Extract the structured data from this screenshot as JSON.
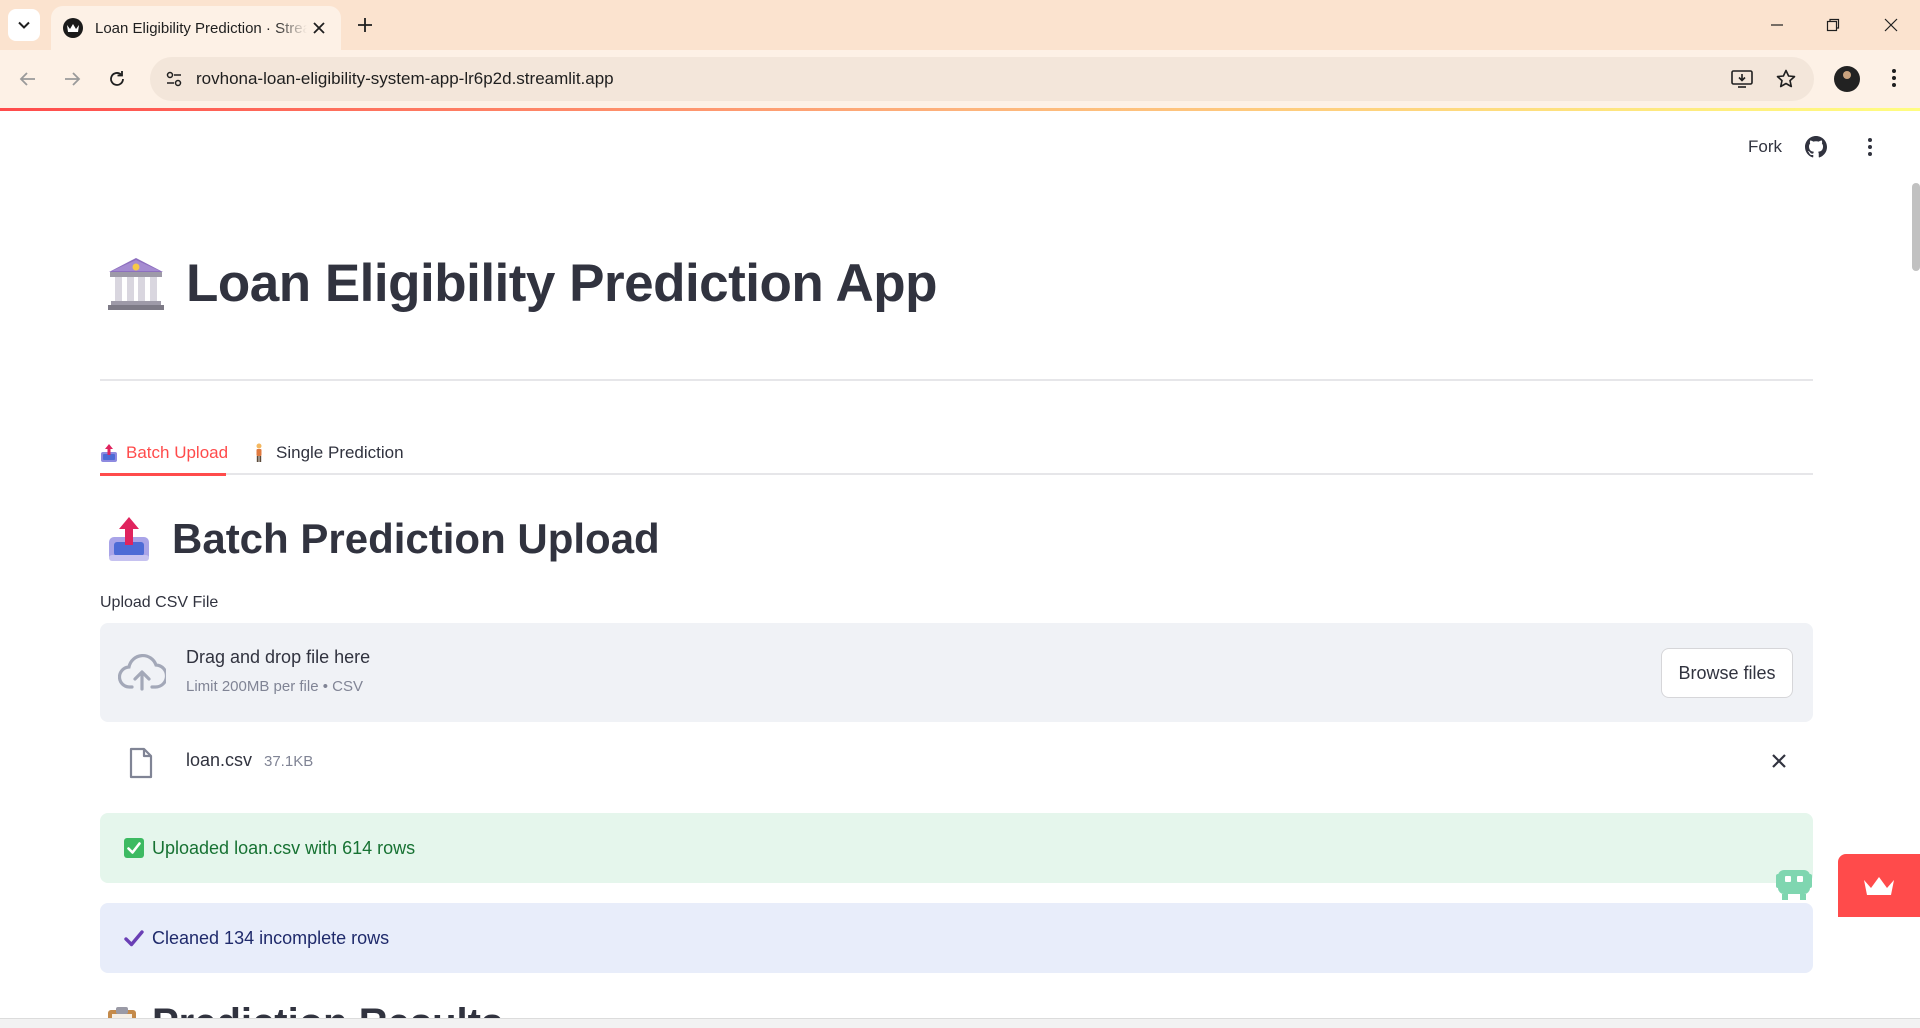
{
  "browser": {
    "tab_title": "Loan Eligibility Prediction · Streamlit",
    "url": "rovhona-loan-eligibility-system-app-lr6p2d.streamlit.app"
  },
  "header": {
    "fork_label": "Fork"
  },
  "page": {
    "title": "Loan Eligibility Prediction App",
    "title_icon": "bank-emoji"
  },
  "tabs": [
    {
      "label": "Batch Upload",
      "icon": "outbox-tray-emoji",
      "active": true
    },
    {
      "label": "Single Prediction",
      "icon": "person-standing-emoji",
      "active": false
    }
  ],
  "batch": {
    "subheader": "Batch Prediction Upload",
    "uploader_label": "Upload CSV File",
    "drop_title": "Drag and drop file here",
    "drop_limit": "Limit 200MB per file • CSV",
    "browse_label": "Browse files",
    "file": {
      "name": "loan.csv",
      "size": "37.1KB"
    },
    "success_message": "Uploaded loan.csv with 614 rows",
    "info_message": "Cleaned 134 incomplete rows",
    "next_section_partial": "Prediction Results"
  },
  "colors": {
    "accent": "#ff4b4b",
    "success_bg": "#e5f6ec",
    "success_text": "#177233",
    "info_bg": "#e8edfa",
    "text": "#31333f"
  }
}
